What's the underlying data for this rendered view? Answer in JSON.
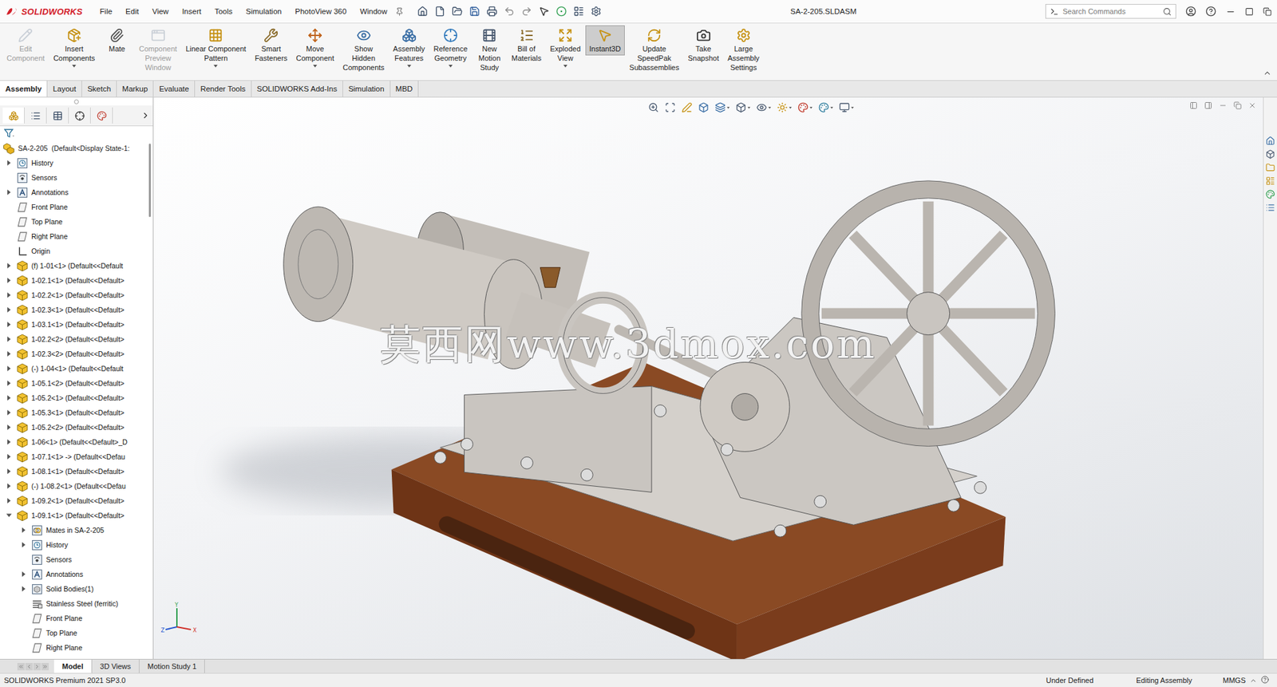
{
  "app": {
    "logo": "SOLIDWORKS",
    "menus": [
      "File",
      "Edit",
      "View",
      "Insert",
      "Tools",
      "Simulation",
      "PhotoView 360",
      "Window"
    ]
  },
  "window": {
    "title": "SA-2-205.SLDASM"
  },
  "search": {
    "placeholder": "Search Commands"
  },
  "ribbon": [
    {
      "lines": [
        "Edit",
        "Component"
      ],
      "disabled": true,
      "selected": false,
      "dropdown": false
    },
    {
      "lines": [
        "Insert",
        "Components"
      ],
      "disabled": false,
      "selected": false,
      "dropdown": true
    },
    {
      "lines": [
        "Mate"
      ],
      "disabled": false,
      "selected": false,
      "dropdown": false
    },
    {
      "lines": [
        "Component",
        "Preview",
        "Window"
      ],
      "disabled": true,
      "selected": false,
      "dropdown": false
    },
    {
      "lines": [
        "Linear Component",
        "Pattern"
      ],
      "disabled": false,
      "selected": false,
      "dropdown": true
    },
    {
      "lines": [
        "Smart",
        "Fasteners"
      ],
      "disabled": false,
      "selected": false,
      "dropdown": false
    },
    {
      "lines": [
        "Move",
        "Component"
      ],
      "disabled": false,
      "selected": false,
      "dropdown": true
    },
    {
      "lines": [
        "Show",
        "Hidden",
        "Components"
      ],
      "disabled": false,
      "selected": false,
      "dropdown": false
    },
    {
      "lines": [
        "Assembly",
        "Features"
      ],
      "disabled": false,
      "selected": false,
      "dropdown": true
    },
    {
      "lines": [
        "Reference",
        "Geometry"
      ],
      "disabled": false,
      "selected": false,
      "dropdown": true
    },
    {
      "lines": [
        "New",
        "Motion",
        "Study"
      ],
      "disabled": false,
      "selected": false,
      "dropdown": false
    },
    {
      "lines": [
        "Bill of",
        "Materials"
      ],
      "disabled": false,
      "selected": false,
      "dropdown": false
    },
    {
      "lines": [
        "Exploded",
        "View"
      ],
      "disabled": false,
      "selected": false,
      "dropdown": true
    },
    {
      "lines": [
        "Instant3D"
      ],
      "disabled": false,
      "selected": true,
      "dropdown": false
    },
    {
      "lines": [
        "Update",
        "SpeedPak",
        "Subassemblies"
      ],
      "disabled": false,
      "selected": false,
      "dropdown": false
    },
    {
      "lines": [
        "Take",
        "Snapshot"
      ],
      "disabled": false,
      "selected": false,
      "dropdown": false
    },
    {
      "lines": [
        "Large",
        "Assembly",
        "Settings"
      ],
      "disabled": false,
      "selected": false,
      "dropdown": false
    }
  ],
  "command_tabs": [
    {
      "label": "Assembly",
      "selected": true
    },
    {
      "label": "Layout",
      "selected": false
    },
    {
      "label": "Sketch",
      "selected": false
    },
    {
      "label": "Markup",
      "selected": false
    },
    {
      "label": "Evaluate",
      "selected": false
    },
    {
      "label": "Render Tools",
      "selected": false
    },
    {
      "label": "SOLIDWORKS Add-Ins",
      "selected": false
    },
    {
      "label": "Simulation",
      "selected": false
    },
    {
      "label": "MBD",
      "selected": false
    }
  ],
  "tree": {
    "root": {
      "label": "SA-2-205  (Default<Display State-1:",
      "kind": "assembly"
    },
    "items": [
      {
        "label": "History",
        "depth": 0,
        "kind": "history",
        "expandable": true,
        "expanded": false
      },
      {
        "label": "Sensors",
        "depth": 0,
        "kind": "sensors",
        "expandable": false,
        "expanded": false
      },
      {
        "label": "Annotations",
        "depth": 0,
        "kind": "annotations",
        "expandable": true,
        "expanded": false
      },
      {
        "label": "Front Plane",
        "depth": 0,
        "kind": "plane",
        "expandable": false,
        "expanded": false
      },
      {
        "label": "Top Plane",
        "depth": 0,
        "kind": "plane",
        "expandable": false,
        "expanded": false
      },
      {
        "label": "Right Plane",
        "depth": 0,
        "kind": "plane",
        "expandable": false,
        "expanded": false
      },
      {
        "label": "Origin",
        "depth": 0,
        "kind": "origin",
        "expandable": false,
        "expanded": false
      },
      {
        "label": "(f) 1-01<1> (Default<<Default",
        "depth": 0,
        "kind": "part",
        "expandable": true,
        "expanded": false
      },
      {
        "label": "1-02.1<1> (Default<<Default>",
        "depth": 0,
        "kind": "part",
        "expandable": true,
        "expanded": false
      },
      {
        "label": "1-02.2<1> (Default<<Default>",
        "depth": 0,
        "kind": "part",
        "expandable": true,
        "expanded": false
      },
      {
        "label": "1-02.3<1> (Default<<Default>",
        "depth": 0,
        "kind": "part",
        "expandable": true,
        "expanded": false
      },
      {
        "label": "1-03.1<1> (Default<<Default>",
        "depth": 0,
        "kind": "part",
        "expandable": true,
        "expanded": false
      },
      {
        "label": "1-02.2<2> (Default<<Default>",
        "depth": 0,
        "kind": "part",
        "expandable": true,
        "expanded": false
      },
      {
        "label": "1-02.3<2> (Default<<Default>",
        "depth": 0,
        "kind": "part",
        "expandable": true,
        "expanded": false
      },
      {
        "label": "(-) 1-04<1> (Default<<Default",
        "depth": 0,
        "kind": "part",
        "expandable": true,
        "expanded": false
      },
      {
        "label": "1-05.1<2> (Default<<Default>",
        "depth": 0,
        "kind": "part",
        "expandable": true,
        "expanded": false
      },
      {
        "label": "1-05.2<1> (Default<<Default>",
        "depth": 0,
        "kind": "part",
        "expandable": true,
        "expanded": false
      },
      {
        "label": "1-05.3<1> (Default<<Default>",
        "depth": 0,
        "kind": "part",
        "expandable": true,
        "expanded": false
      },
      {
        "label": "1-05.2<2> (Default<<Default>",
        "depth": 0,
        "kind": "part",
        "expandable": true,
        "expanded": false
      },
      {
        "label": "1-06<1> (Default<<Default>_D",
        "depth": 0,
        "kind": "part",
        "expandable": true,
        "expanded": false
      },
      {
        "label": "1-07.1<1> -> (Default<<Defau",
        "depth": 0,
        "kind": "part",
        "expandable": true,
        "expanded": false
      },
      {
        "label": "1-08.1<1> (Default<<Default>",
        "depth": 0,
        "kind": "part",
        "expandable": true,
        "expanded": false
      },
      {
        "label": "(-) 1-08.2<1> (Default<<Defau",
        "depth": 0,
        "kind": "part",
        "expandable": true,
        "expanded": false
      },
      {
        "label": "1-09.2<1> (Default<<Default>",
        "depth": 0,
        "kind": "part",
        "expandable": true,
        "expanded": false
      },
      {
        "label": "1-09.1<1> (Default<<Default>",
        "depth": 0,
        "kind": "part",
        "expandable": true,
        "expanded": true
      },
      {
        "label": "Mates in SA-2-205",
        "depth": 1,
        "kind": "mates",
        "expandable": true,
        "expanded": false
      },
      {
        "label": "History",
        "depth": 1,
        "kind": "history",
        "expandable": true,
        "expanded": false
      },
      {
        "label": "Sensors",
        "depth": 1,
        "kind": "sensors",
        "expandable": false,
        "expanded": false
      },
      {
        "label": "Annotations",
        "depth": 1,
        "kind": "annotations",
        "expandable": true,
        "expanded": false
      },
      {
        "label": "Solid Bodies(1)",
        "depth": 1,
        "kind": "bodies",
        "expandable": true,
        "expanded": false
      },
      {
        "label": "Stainless Steel (ferritic)",
        "depth": 1,
        "kind": "material",
        "expandable": false,
        "expanded": false
      },
      {
        "label": "Front Plane",
        "depth": 1,
        "kind": "plane",
        "expandable": false,
        "expanded": false
      },
      {
        "label": "Top Plane",
        "depth": 1,
        "kind": "plane",
        "expandable": false,
        "expanded": false
      },
      {
        "label": "Right Plane",
        "depth": 1,
        "kind": "plane",
        "expandable": false,
        "expanded": false
      }
    ]
  },
  "viewport": {
    "watermark": "莫西网www.3dmox.com",
    "triad": [
      "Y",
      "Z",
      "X"
    ]
  },
  "bottom_tabs": [
    {
      "label": "Model",
      "selected": true
    },
    {
      "label": "3D Views",
      "selected": false
    },
    {
      "label": "Motion Study 1",
      "selected": false
    }
  ],
  "status_bar": {
    "product": "SOLIDWORKS Premium 2021 SP3.0",
    "state": "Under Defined",
    "mode": "Editing Assembly",
    "units": "MMGS"
  }
}
